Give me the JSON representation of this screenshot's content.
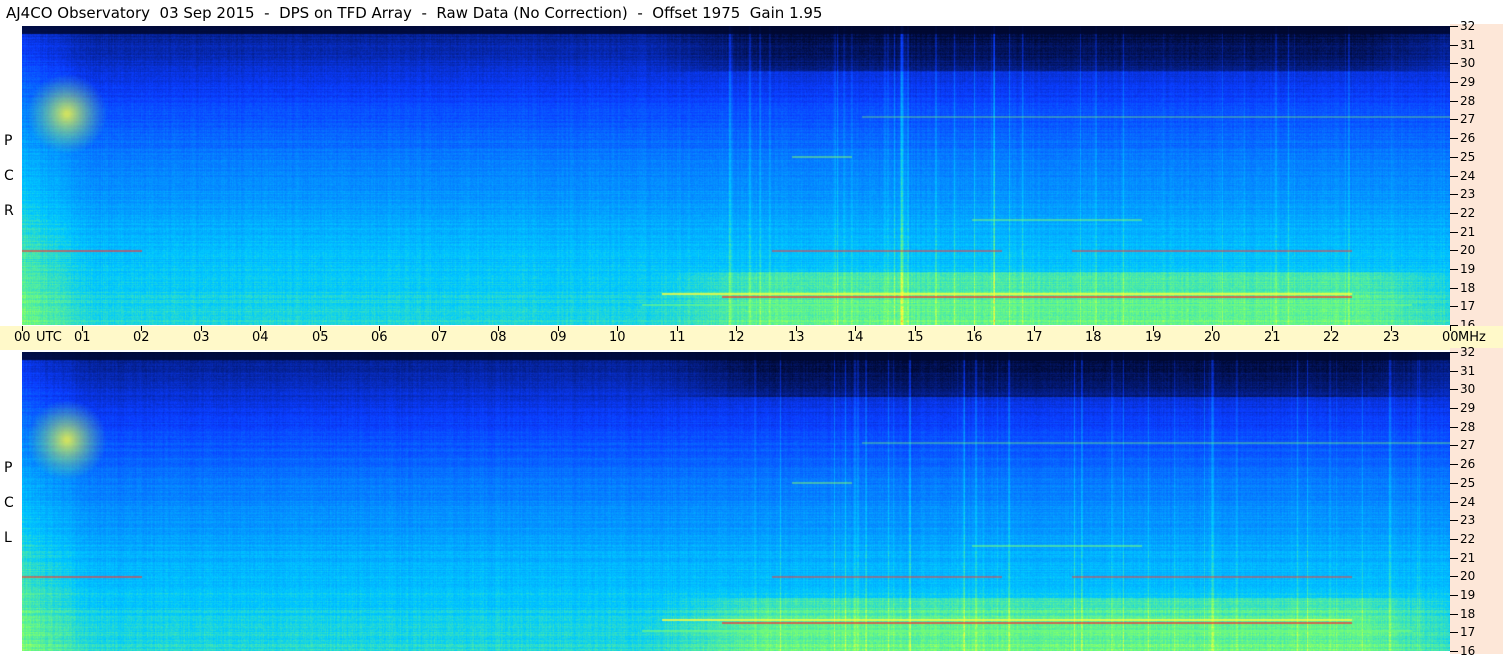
{
  "title": "AJ4CO Observatory  03 Sep 2015  -  DPS on TFD Array  -  Raw Data (No Correction)  -  Offset 1975  Gain 1.95",
  "panels": [
    {
      "id": "rcp",
      "letters": [
        "P",
        "C",
        "R"
      ]
    },
    {
      "id": "lcp",
      "letters": [
        "P",
        "C",
        "L"
      ]
    }
  ],
  "time_axis": {
    "labels": [
      "00",
      "UTC",
      "01",
      "02",
      "03",
      "04",
      "05",
      "06",
      "07",
      "08",
      "09",
      "10",
      "11",
      "12",
      "13",
      "14",
      "15",
      "16",
      "17",
      "18",
      "19",
      "20",
      "21",
      "22",
      "23",
      "00",
      "MHz"
    ]
  },
  "colors": {
    "background_dark": "#000830",
    "band_blue": "#0a3cff",
    "band_cyan": "#00c8ff",
    "band_green": "#7dff6e",
    "band_yellow": "#ffff3a",
    "band_red": "#ff3030",
    "time_bar": "#fff9c9",
    "freq_axis": "#fde7d8"
  },
  "chart_data": {
    "type": "heatmap",
    "x_label": "UTC",
    "y_label": "MHz",
    "x_range": [
      0,
      24
    ],
    "y_range": [
      16,
      32
    ],
    "x_ticks": [
      "00",
      "01",
      "02",
      "03",
      "04",
      "05",
      "06",
      "07",
      "08",
      "09",
      "10",
      "11",
      "12",
      "13",
      "14",
      "15",
      "16",
      "17",
      "18",
      "19",
      "20",
      "21",
      "22",
      "23",
      "00"
    ],
    "y_ticks": [
      "16",
      "17",
      "18",
      "19",
      "20",
      "21",
      "22",
      "23",
      "24",
      "25",
      "26",
      "27",
      "28",
      "29",
      "30",
      "31",
      "32"
    ],
    "series": [
      {
        "name": "RCP"
      },
      {
        "name": "LCP"
      }
    ]
  }
}
